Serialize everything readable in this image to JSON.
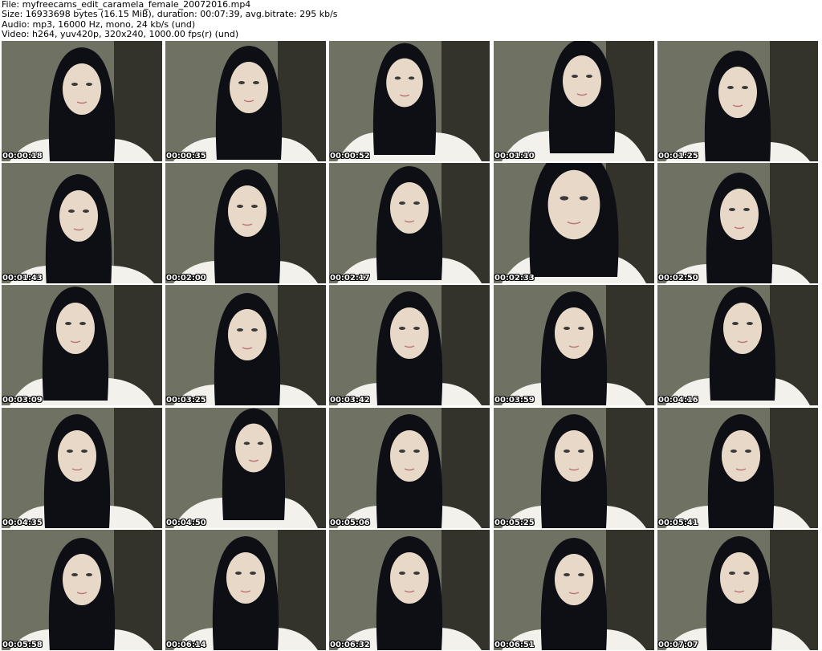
{
  "header": {
    "line1": "File: myfreecams_edit_caramela_female_20072016.mp4",
    "line2": "Size: 16933698 bytes (16.15 MiB), duration: 00:07:39, avg.bitrate: 295 kb/s",
    "line3": "Audio: mp3, 16000 Hz, mono, 24 kb/s (und)",
    "line4": "Video: h264, yuv420p, 320x240, 1000.00 fps(r) (und)"
  },
  "colors": {
    "hair": "#0d0f14",
    "skin": "#e8d8c8",
    "shirt": "#f2f1ec",
    "wall": "#6f7163",
    "dark_wall": "#1a1a16"
  },
  "thumbnails": [
    {
      "timestamp": "00:00:18"
    },
    {
      "timestamp": "00:00:35"
    },
    {
      "timestamp": "00:00:52"
    },
    {
      "timestamp": "00:01:10"
    },
    {
      "timestamp": "00:01:25"
    },
    {
      "timestamp": "00:01:43"
    },
    {
      "timestamp": "00:02:00"
    },
    {
      "timestamp": "00:02:17"
    },
    {
      "timestamp": "00:02:33"
    },
    {
      "timestamp": "00:02:50"
    },
    {
      "timestamp": "00:03:09"
    },
    {
      "timestamp": "00:03:25"
    },
    {
      "timestamp": "00:03:42"
    },
    {
      "timestamp": "00:03:59"
    },
    {
      "timestamp": "00:04:16"
    },
    {
      "timestamp": "00:04:35"
    },
    {
      "timestamp": "00:04:50"
    },
    {
      "timestamp": "00:05:06"
    },
    {
      "timestamp": "00:05:25"
    },
    {
      "timestamp": "00:05:41"
    },
    {
      "timestamp": "00:05:58"
    },
    {
      "timestamp": "00:06:14"
    },
    {
      "timestamp": "00:06:32"
    },
    {
      "timestamp": "00:06:51"
    },
    {
      "timestamp": "00:07:07"
    }
  ]
}
